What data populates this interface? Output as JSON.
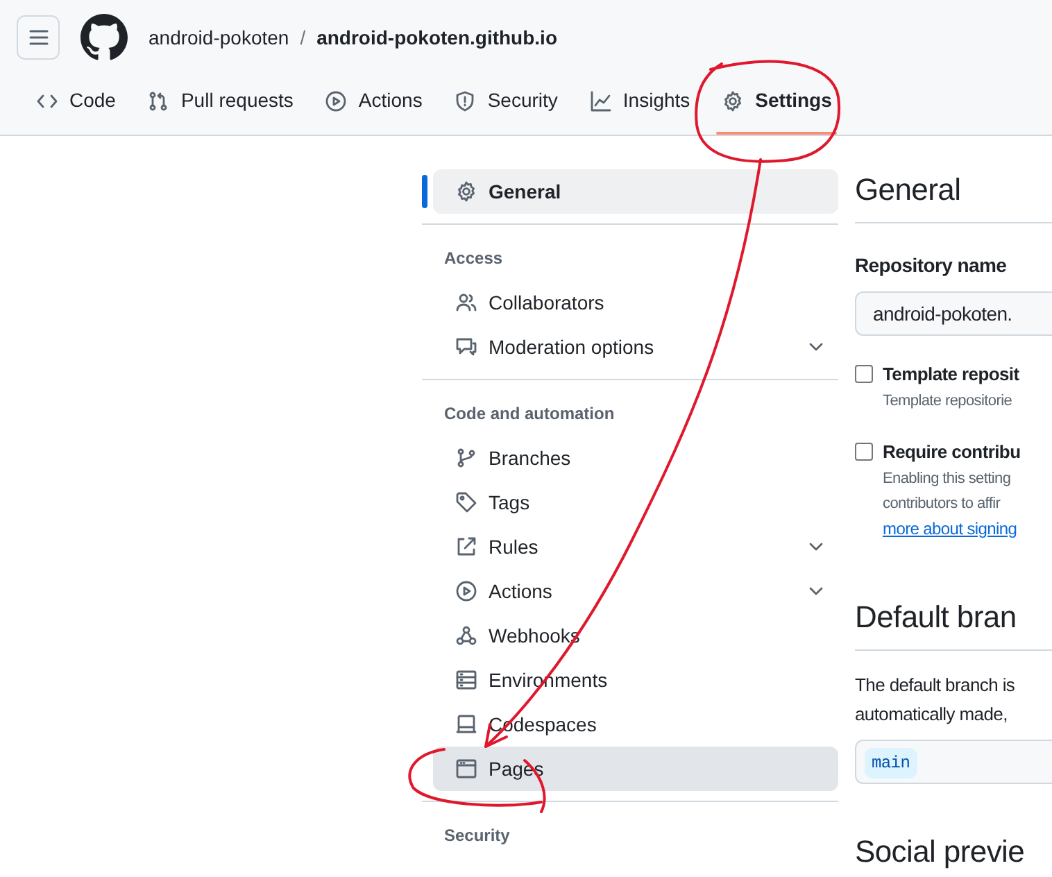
{
  "header": {
    "owner": "android-pokoten",
    "separator": "/",
    "repo": "android-pokoten.github.io"
  },
  "tabs": [
    {
      "label": "Code",
      "selected": false
    },
    {
      "label": "Pull requests",
      "selected": false
    },
    {
      "label": "Actions",
      "selected": false
    },
    {
      "label": "Security",
      "selected": false
    },
    {
      "label": "Insights",
      "selected": false
    },
    {
      "label": "Settings",
      "selected": true
    }
  ],
  "sidebar": {
    "groups": [
      {
        "items": [
          {
            "label": "General",
            "selected": true,
            "highlighted": false,
            "expandable": false
          }
        ]
      },
      {
        "heading": "Access",
        "items": [
          {
            "label": "Collaborators",
            "selected": false,
            "highlighted": false,
            "expandable": false
          },
          {
            "label": "Moderation options",
            "selected": false,
            "highlighted": false,
            "expandable": true
          }
        ]
      },
      {
        "heading": "Code and automation",
        "items": [
          {
            "label": "Branches",
            "selected": false,
            "highlighted": false,
            "expandable": false
          },
          {
            "label": "Tags",
            "selected": false,
            "highlighted": false,
            "expandable": false
          },
          {
            "label": "Rules",
            "selected": false,
            "highlighted": false,
            "expandable": true
          },
          {
            "label": "Actions",
            "selected": false,
            "highlighted": false,
            "expandable": true
          },
          {
            "label": "Webhooks",
            "selected": false,
            "highlighted": false,
            "expandable": false
          },
          {
            "label": "Environments",
            "selected": false,
            "highlighted": false,
            "expandable": false
          },
          {
            "label": "Codespaces",
            "selected": false,
            "highlighted": false,
            "expandable": false
          },
          {
            "label": "Pages",
            "selected": false,
            "highlighted": true,
            "expandable": false
          }
        ]
      },
      {
        "heading": "Security"
      }
    ]
  },
  "content": {
    "title": "General",
    "repo_name_label": "Repository name",
    "repo_name_value": "android-pokoten.",
    "options": [
      {
        "label": "Template reposit",
        "checked": false,
        "description": [
          "Template repositorie"
        ]
      },
      {
        "label": "Require contribu",
        "checked": false,
        "description": [
          "Enabling this setting",
          "contributors to affir"
        ],
        "link": "more about signing"
      }
    ],
    "default_branch": {
      "title": "Default bran",
      "description": [
        "The default branch is",
        "automatically made,"
      ],
      "branch": "main"
    },
    "social_title": "Social previe"
  }
}
